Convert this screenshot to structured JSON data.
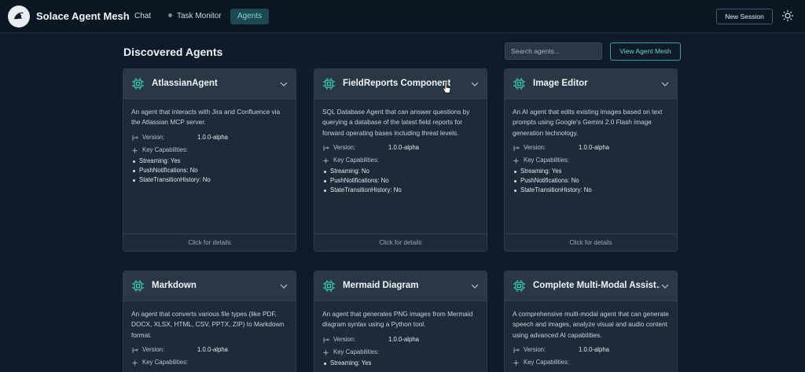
{
  "header": {
    "app_title": "Solace Agent Mesh",
    "nav": [
      {
        "label": "Chat"
      },
      {
        "label": "Task Monitor"
      },
      {
        "label": "Agents",
        "active": true
      }
    ],
    "new_session_label": "New Session",
    "theme_icon": "sun-icon"
  },
  "main": {
    "title": "Discovered Agents",
    "search_placeholder": "Search agents...",
    "view_mesh_label": "View Agent Mesh"
  },
  "labels": {
    "version": "Version:",
    "key_capabilities": "Key Capabilities:",
    "click_for_details": "Click for details"
  },
  "agents": [
    {
      "name": "AtlassianAgent",
      "description": "An agent that interacts with Jira and Confluence via the Atlassian MCP server.",
      "version": "1.0.0-alpha",
      "capabilities": [
        "Streaming: Yes",
        "PushNotifications: No",
        "StateTransitionHistory: No"
      ]
    },
    {
      "name": "FieldReports Component",
      "description": "SQL Database Agent that can answer questions by querying a database of the latest field reports for forward operating bases including threat levels.",
      "version": "1.0.0-alpha",
      "capabilities": [
        "Streaming: No",
        "PushNotifications: No",
        "StateTransitionHistory: No"
      ]
    },
    {
      "name": "Image Editor",
      "description": "An AI agent that edits existing images based on text prompts using Google's Gemini 2.0 Flash image generation technology.",
      "version": "1.0.0-alpha",
      "capabilities": [
        "Streaming: Yes",
        "PushNotifications: No",
        "StateTransitionHistory: No"
      ]
    },
    {
      "name": "Markdown",
      "description": "An agent that converts various file types (like PDF, DOCX, XLSX, HTML, CSV, PPTX, ZIP) to Markdown format.",
      "version": "1.0.0-alpha",
      "capabilities": []
    },
    {
      "name": "Mermaid Diagram",
      "description": "An agent that generates PNG images from Mermaid diagram syntax using a Python tool.",
      "version": "1.0.0-alpha",
      "capabilities": [
        "Streaming: Yes"
      ]
    },
    {
      "name": "Complete Multi-Modal Assist…",
      "description": "A comprehensive multi-modal agent that can generate speech and images, analyze visual and audio content using advanced AI capabilities.",
      "version": "1.0.0-alpha",
      "capabilities": []
    }
  ]
}
